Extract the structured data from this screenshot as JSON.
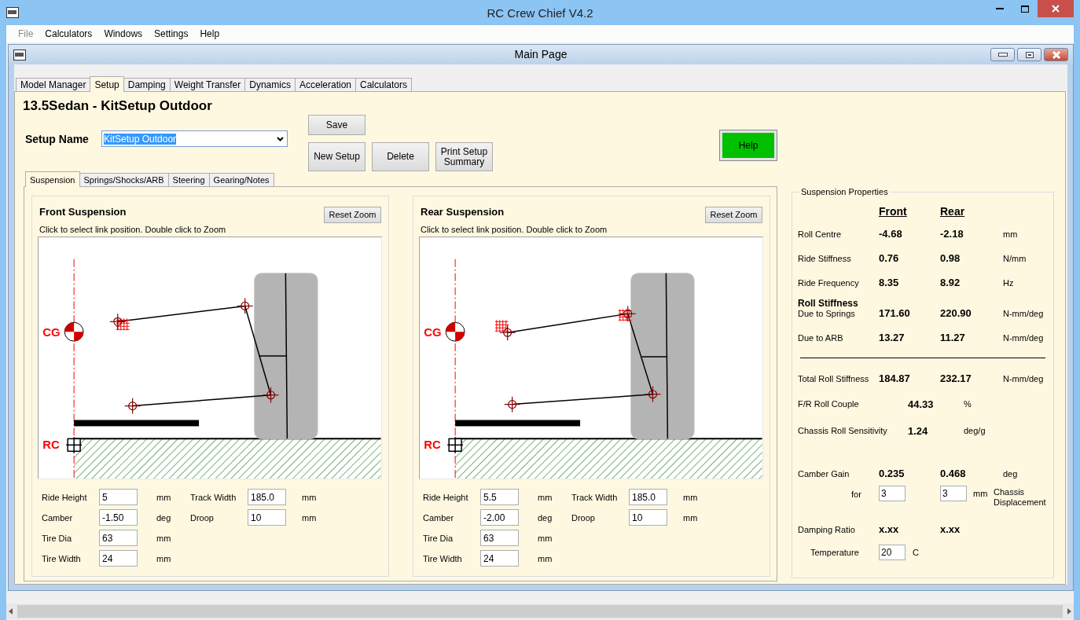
{
  "window": {
    "title": "RC Crew Chief V4.2"
  },
  "menu": [
    {
      "label": "File",
      "disabled": true
    },
    {
      "label": "Calculators",
      "disabled": false
    },
    {
      "label": "Windows",
      "disabled": false
    },
    {
      "label": "Settings",
      "disabled": false
    },
    {
      "label": "Help",
      "disabled": false
    }
  ],
  "document": {
    "title": "Main Page"
  },
  "tabs": [
    {
      "label": "Model Manager",
      "selected": false
    },
    {
      "label": "Setup",
      "selected": true
    },
    {
      "label": "Damping",
      "selected": false
    },
    {
      "label": "Weight Transfer",
      "selected": false
    },
    {
      "label": "Dynamics",
      "selected": false
    },
    {
      "label": "Acceleration",
      "selected": false
    },
    {
      "label": "Calculators",
      "selected": false
    }
  ],
  "setup": {
    "title": "13.5Sedan - KitSetup Outdoor",
    "name_label": "Setup Name",
    "name_value": "KitSetup Outdoor",
    "name_highlighted": true
  },
  "buttons": {
    "save": "Save",
    "new": "New Setup",
    "delete": "Delete",
    "print": "Print Setup Summary",
    "help": "Help"
  },
  "sub_tabs": [
    {
      "label": "Suspension",
      "selected": true
    },
    {
      "label": "Springs/Shocks/ARB",
      "selected": false
    },
    {
      "label": "Steering",
      "selected": false
    },
    {
      "label": "Gearing/Notes",
      "selected": false
    }
  ],
  "suspensions": [
    {
      "title": "Front Suspension",
      "reset_button": "Reset Zoom",
      "hint": "Click to select link position. Double click to Zoom",
      "cg_label": "CG",
      "rc_label": "RC",
      "rows": [
        [
          {
            "label": "Ride Height",
            "value": "5",
            "unit": "mm"
          },
          {
            "label": "Track Width",
            "value": "185.0",
            "unit": "mm"
          }
        ],
        [
          {
            "label": "Camber",
            "value": "-1.50",
            "unit": "deg"
          },
          {
            "label": "Droop",
            "value": "10",
            "unit": "mm"
          }
        ],
        [
          {
            "label": "Tire Dia",
            "value": "63",
            "unit": "mm"
          }
        ],
        [
          {
            "label": "Tire Width",
            "value": "24",
            "unit": "mm"
          }
        ]
      ]
    },
    {
      "title": "Rear Suspension",
      "reset_button": "Reset Zoom",
      "hint": "Click to select link position. Double click to Zoom",
      "cg_label": "CG",
      "rc_label": "RC",
      "rows": [
        [
          {
            "label": "Ride Height",
            "value": "5.5",
            "unit": "mm"
          },
          {
            "label": "Track Width",
            "value": "185.0",
            "unit": "mm"
          }
        ],
        [
          {
            "label": "Camber",
            "value": "-2.00",
            "unit": "deg"
          },
          {
            "label": "Droop",
            "value": "10",
            "unit": "mm"
          }
        ],
        [
          {
            "label": "Tire Dia",
            "value": "63",
            "unit": "mm"
          }
        ],
        [
          {
            "label": "Tire Width",
            "value": "24",
            "unit": "mm"
          }
        ]
      ]
    }
  ],
  "properties": {
    "title": "Suspension Properties",
    "columns": [
      "Front",
      "Rear"
    ],
    "rows": [
      {
        "kind": "pair",
        "label": "Roll Centre",
        "front": "-4.68",
        "rear": "-2.18",
        "unit": "mm"
      },
      {
        "kind": "pair",
        "label": "Ride Stiffness",
        "front": "0.76",
        "rear": "0.98",
        "unit": "N/mm"
      },
      {
        "kind": "pair",
        "label": "Ride Frequency",
        "front": "8.35",
        "rear": "8.92",
        "unit": "Hz"
      },
      {
        "kind": "heading",
        "label": "Roll Stiffness"
      },
      {
        "kind": "pair",
        "label": "Due to Springs",
        "front": "171.60",
        "rear": "220.90",
        "unit": "N-mm/deg"
      },
      {
        "kind": "pair",
        "label": "Due to ARB",
        "front": "13.27",
        "rear": "11.27",
        "unit": "N-mm/deg"
      },
      {
        "kind": "rule"
      },
      {
        "kind": "pair",
        "label": "Total Roll Stiffness",
        "front": "184.87",
        "rear": "232.17",
        "unit": "N-mm/deg"
      },
      {
        "kind": "single",
        "label": "F/R Roll Couple",
        "value": "44.33",
        "unit": "%"
      },
      {
        "kind": "single",
        "label": "Chassis Roll Sensitivity",
        "value": "1.24",
        "unit": "deg/g"
      },
      {
        "kind": "pair",
        "label": "Camber Gain",
        "front": "0.235",
        "rear": "0.468",
        "unit": "deg"
      },
      {
        "kind": "inputs",
        "label": "for",
        "front": "3",
        "rear": "3",
        "unit": "mm",
        "note": "Chassis Displacement"
      },
      {
        "kind": "pair",
        "label": "Damping Ratio",
        "front": "x.xx",
        "rear": "x.xx"
      },
      {
        "kind": "input",
        "label": "Temperature",
        "field": "20",
        "field_unit": "C"
      }
    ]
  }
}
